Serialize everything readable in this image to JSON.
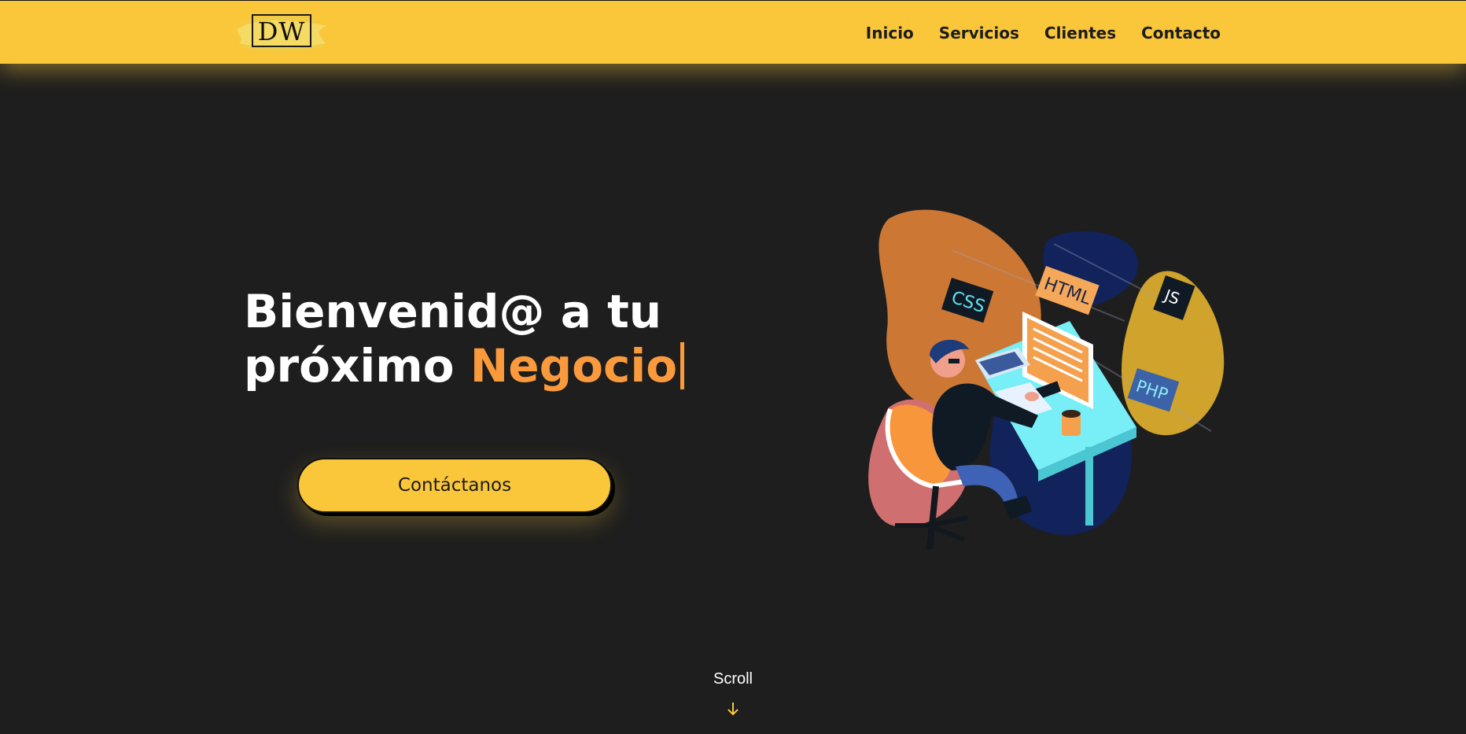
{
  "header": {
    "logo_text": "DW",
    "nav": [
      {
        "label": "Inicio"
      },
      {
        "label": "Servicios"
      },
      {
        "label": "Clientes"
      },
      {
        "label": "Contacto"
      }
    ]
  },
  "hero": {
    "title_line1": "Bienvenid@ a tu",
    "title_line2_prefix": "próximo",
    "title_accent_word": "Negocio",
    "cta_label": "Contáctanos",
    "illustration": {
      "icon": "developer-at-desk-illustration",
      "tags": [
        "CSS",
        "HTML",
        "JS",
        "PHP"
      ]
    }
  },
  "scroll": {
    "label": "Scroll",
    "icon": "arrow-down-icon"
  },
  "colors": {
    "brand_yellow": "#fac73a",
    "accent_orange": "#fb9a3c",
    "background": "#1e1e1e",
    "text_light": "#ffffff",
    "text_dark": "#1c1c1c"
  }
}
